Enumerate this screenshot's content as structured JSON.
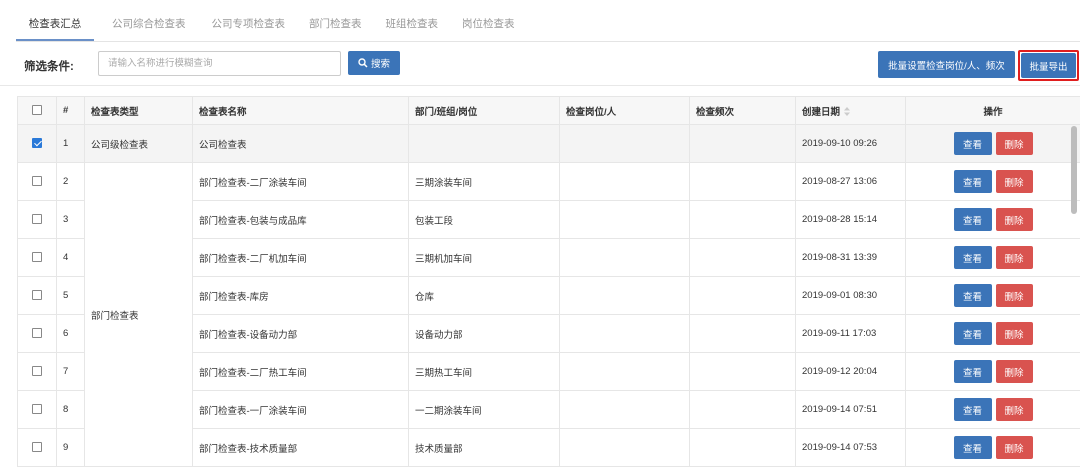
{
  "tabs": [
    {
      "label": "检查表汇总",
      "active": true
    },
    {
      "label": "公司综合检查表",
      "active": false
    },
    {
      "label": "公司专项检查表",
      "active": false
    },
    {
      "label": "部门检查表",
      "active": false
    },
    {
      "label": "班组检查表",
      "active": false
    },
    {
      "label": "岗位检查表",
      "active": false
    }
  ],
  "filter": {
    "label": "筛选条件:",
    "search_placeholder": "请输入名称进行模糊查询",
    "search_value": "",
    "search_button": "搜索",
    "batch_button": "批量设置检查岗位/人、频次",
    "export_button": "批量导出"
  },
  "table": {
    "headers": {
      "index": "#",
      "type": "检查表类型",
      "name": "检查表名称",
      "dept": "部门/班组/岗位",
      "post": "检查岗位/人",
      "freq": "检查频次",
      "created": "创建日期",
      "ops": "操作"
    },
    "view_label": "查看",
    "delete_label": "删除",
    "rows": [
      {
        "index": "1",
        "type": "公司级检查表",
        "name": "公司检查表",
        "dept": "",
        "post": "",
        "freq": "",
        "created": "2019-09-10 09:26",
        "checked": true
      },
      {
        "index": "2",
        "type": "部门检查表",
        "name": "部门检查表-二厂涂装车间",
        "dept": "三期涂装车间",
        "post": "",
        "freq": "",
        "created": "2019-08-27 13:06",
        "checked": false
      },
      {
        "index": "3",
        "type": "",
        "name": "部门检查表-包装与成品库",
        "dept": "包装工段",
        "post": "",
        "freq": "",
        "created": "2019-08-28 15:14",
        "checked": false
      },
      {
        "index": "4",
        "type": "",
        "name": "部门检查表-二厂机加车间",
        "dept": "三期机加车间",
        "post": "",
        "freq": "",
        "created": "2019-08-31 13:39",
        "checked": false
      },
      {
        "index": "5",
        "type": "",
        "name": "部门检查表-库房",
        "dept": "仓库",
        "post": "",
        "freq": "",
        "created": "2019-09-01 08:30",
        "checked": false
      },
      {
        "index": "6",
        "type": "",
        "name": "部门检查表-设备动力部",
        "dept": "设备动力部",
        "post": "",
        "freq": "",
        "created": "2019-09-11 17:03",
        "checked": false
      },
      {
        "index": "7",
        "type": "",
        "name": "部门检查表-二厂热工车间",
        "dept": "三期热工车间",
        "post": "",
        "freq": "",
        "created": "2019-09-12 20:04",
        "checked": false
      },
      {
        "index": "8",
        "type": "",
        "name": "部门检查表-一厂涂装车间",
        "dept": "一二期涂装车间",
        "post": "",
        "freq": "",
        "created": "2019-09-14 07:51",
        "checked": false
      },
      {
        "index": "9",
        "type": "",
        "name": "部门检查表-技术质量部",
        "dept": "技术质量部",
        "post": "",
        "freq": "",
        "created": "2019-09-14 07:53",
        "checked": false
      }
    ]
  },
  "colors": {
    "primary": "#3b74b8",
    "danger": "#d9534f",
    "highlight": "#e01e1e",
    "checkbox": "#2a79d8"
  }
}
